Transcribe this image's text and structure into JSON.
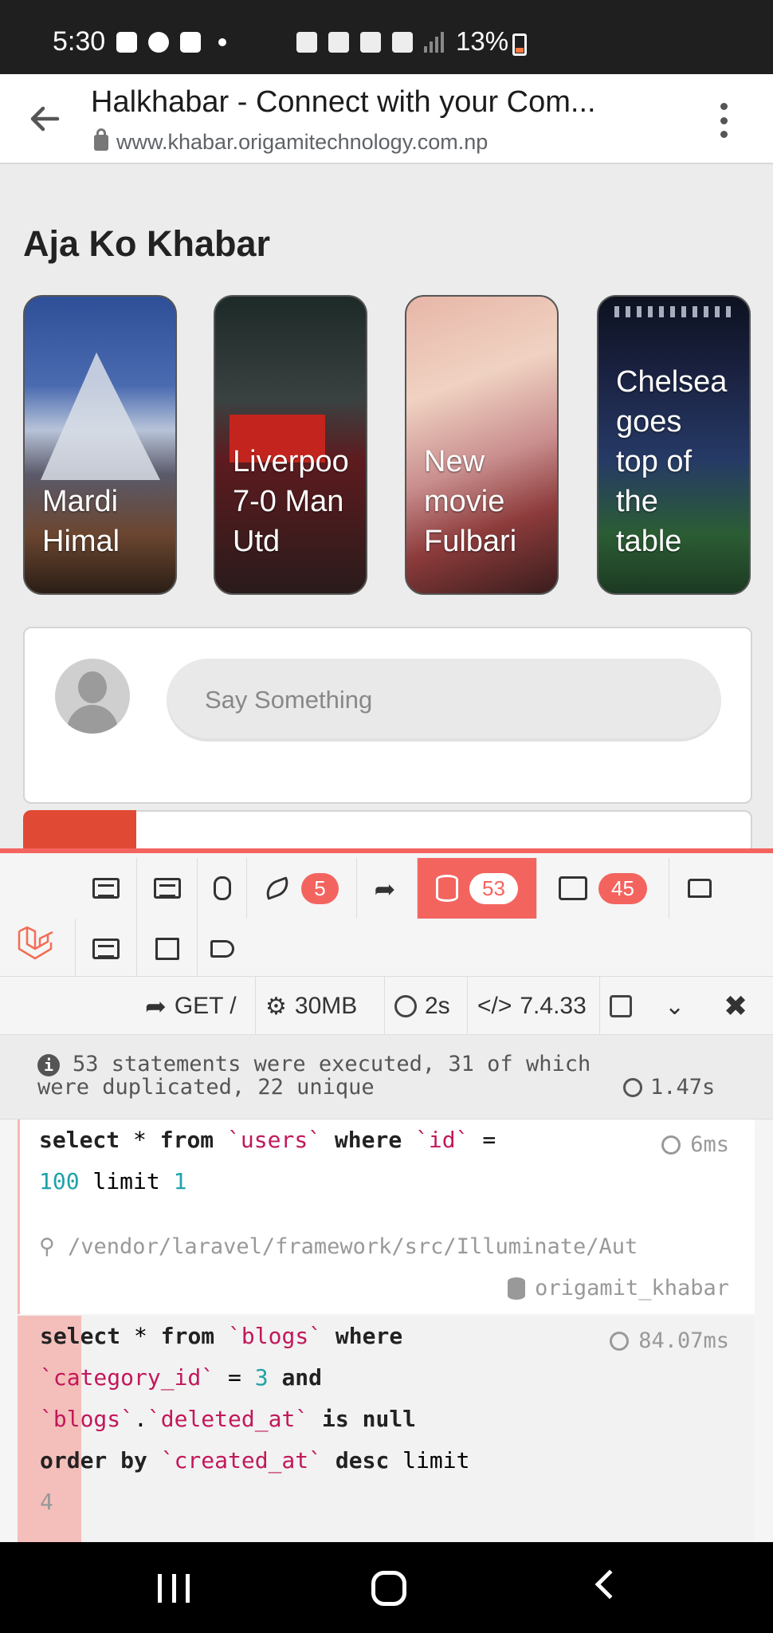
{
  "status_bar": {
    "time": "5:30",
    "battery": "13%"
  },
  "browser": {
    "page_title": "Halkhabar - Connect with your Com...",
    "url": "www.khabar.origamitechnology.com.np"
  },
  "page": {
    "section_title": "Aja Ko Khabar",
    "stories": [
      {
        "caption": "Mardi\nHimal"
      },
      {
        "caption": "Liverpoo\n7-0 Man\nUtd"
      },
      {
        "caption": "New\nmovie\nFulbari"
      },
      {
        "caption": "Chelsea\ngoes\ntop of\nthe\ntable"
      }
    ],
    "post_placeholder": "Say Something"
  },
  "debugbar": {
    "badges": {
      "timeline": "5",
      "queries": "53",
      "models": "45"
    },
    "request": {
      "method_path": "GET /",
      "memory": "30MB",
      "time": "2s",
      "php": "7.4.33"
    },
    "summary": {
      "line1": "53 statements were executed, 31 of which",
      "line2": "were duplicated, 22 unique",
      "duration": "1.47s"
    },
    "queries": [
      {
        "time": "6ms",
        "path": "/vendor/laravel/framework/src/Illuminate/Aut",
        "connection": "origamit_khabar"
      },
      {
        "time": "84.07ms"
      }
    ]
  }
}
